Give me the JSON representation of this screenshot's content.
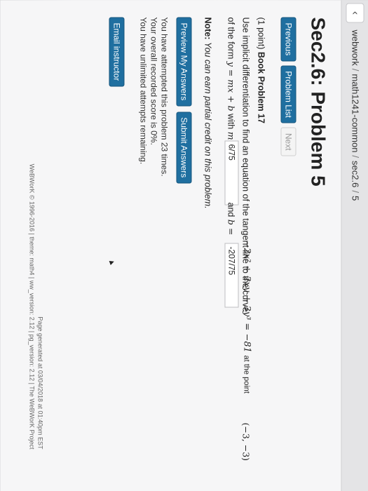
{
  "browser": {
    "back_icon": "chevron-left-icon",
    "back_glyph": "‹"
  },
  "breadcrumb": {
    "parts": [
      "webwork",
      "math1241-common",
      "sec2.6",
      "5"
    ],
    "separator": "/"
  },
  "page": {
    "title": "Sec2.6: Problem 5"
  },
  "nav": {
    "previous": "Previous",
    "problem_list": "Problem List",
    "next": "Next"
  },
  "problem": {
    "points": "(1 point)",
    "book": "Book Problem 17",
    "line1_text": "Use implicit differentiation to find an equation of the tangent line to the curve",
    "equation": "−2x² + 2xy + 3y³ = −81",
    "at_point_label": "at the point",
    "point": "(−3, −3)",
    "line2_prefix": "of the form",
    "form": "y = mx + b",
    "with_label": "with",
    "m_label": "m =",
    "m_value": "6/75",
    "and_label": "and",
    "b_label": "b =",
    "b_value": "-207/75"
  },
  "note": {
    "label": "Note:",
    "text": "You can earn partial credit on this problem."
  },
  "actions": {
    "preview": "Preview My Answers",
    "submit": "Submit Answers"
  },
  "status": {
    "line1": "You have attempted this problem 23 times.",
    "line2": "Your overall recorded score is 0%.",
    "line3": "You have unlimited attempts remaining."
  },
  "email": {
    "label": "Email instructor"
  },
  "footer": {
    "line1": "Page generated at 03/04/2018 at 01:40pm EST",
    "line2": "WeBWorK © 1996-2016 | theme: math4 | ww_version: 2.12 | pg_version: 2.12 | The WeBWorK Project"
  },
  "colors": {
    "primary_button": "#1f6fa0",
    "disabled_button": "#f4f4f4",
    "page_background": "#f6f6f7"
  }
}
